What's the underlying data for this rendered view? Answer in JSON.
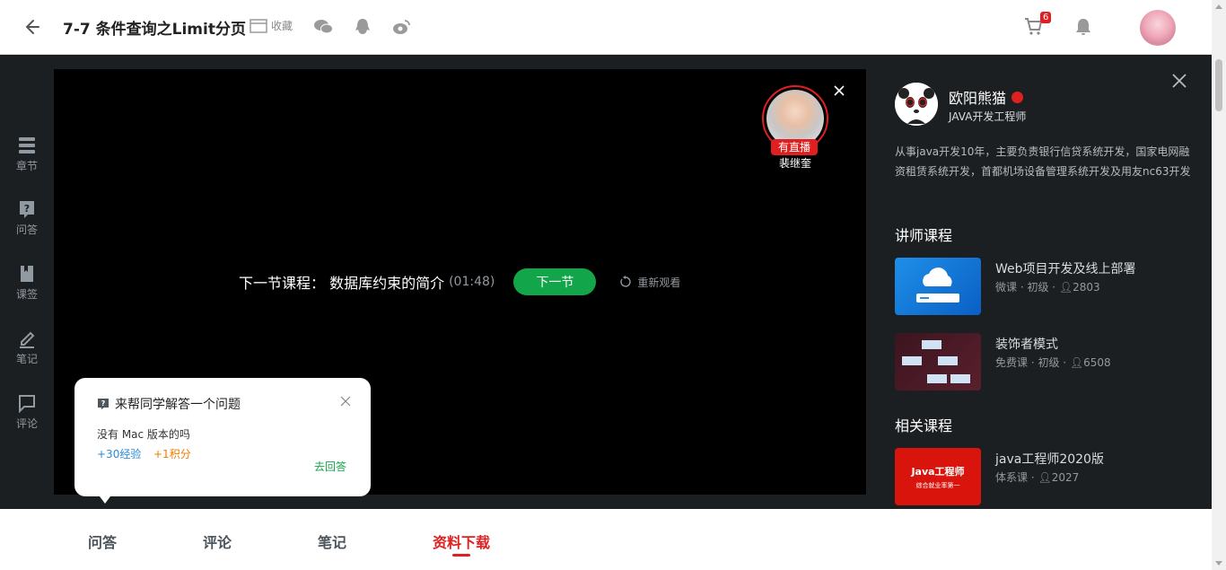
{
  "header": {
    "title": "7-7 条件查询之Limit分页",
    "collect_label": "收藏",
    "cart_count": "6"
  },
  "left_nav": [
    {
      "label": "章节",
      "icon": "chapter-icon"
    },
    {
      "label": "问答",
      "icon": "question-icon"
    },
    {
      "label": "课签",
      "icon": "bookmark-icon"
    },
    {
      "label": "笔记",
      "icon": "pen-icon"
    },
    {
      "label": "评论",
      "icon": "comment-icon"
    }
  ],
  "video": {
    "next_label": "下一节课程：  数据库约束的简介",
    "next_time": "(01:48)",
    "next_button": "下一节",
    "replay_label": "重新观看",
    "live_tag": "有直播",
    "live_name": "裴继奎"
  },
  "popup": {
    "title": "来帮同学解答一个问题",
    "question": "没有 Mac 版本的吗",
    "exp": "+30经验",
    "points": "+1积分",
    "answer_link": "去回答"
  },
  "teacher": {
    "name": "欧阳熊猫",
    "role": "JAVA开发工程师",
    "bio": "从事java开发10年，主要负责银行信贷系统开发，国家电网融资租赁系统开发，首都机场设备管理系统开发及用友nc63开发"
  },
  "teacher_courses_title": "讲师课程",
  "teacher_courses": [
    {
      "title": "Web项目开发及线上部署",
      "meta": "微课 · 初级 · ",
      "count": "2803"
    },
    {
      "title": "装饰者模式",
      "meta": "免费课 · 初级 · ",
      "count": "6508"
    }
  ],
  "related_courses_title": "相关课程",
  "related_courses": [
    {
      "title": "java工程师2020版",
      "meta": "体系课 · ",
      "count": "2027",
      "thumb_title": "Java工程师",
      "thumb_sub": "综合就业率第一"
    }
  ],
  "bottom_tabs": [
    "问答",
    "评论",
    "笔记",
    "资料下载"
  ],
  "colors": {
    "accent": "#e02020",
    "green": "#13a54a",
    "dark_bg": "#1c1f21"
  }
}
